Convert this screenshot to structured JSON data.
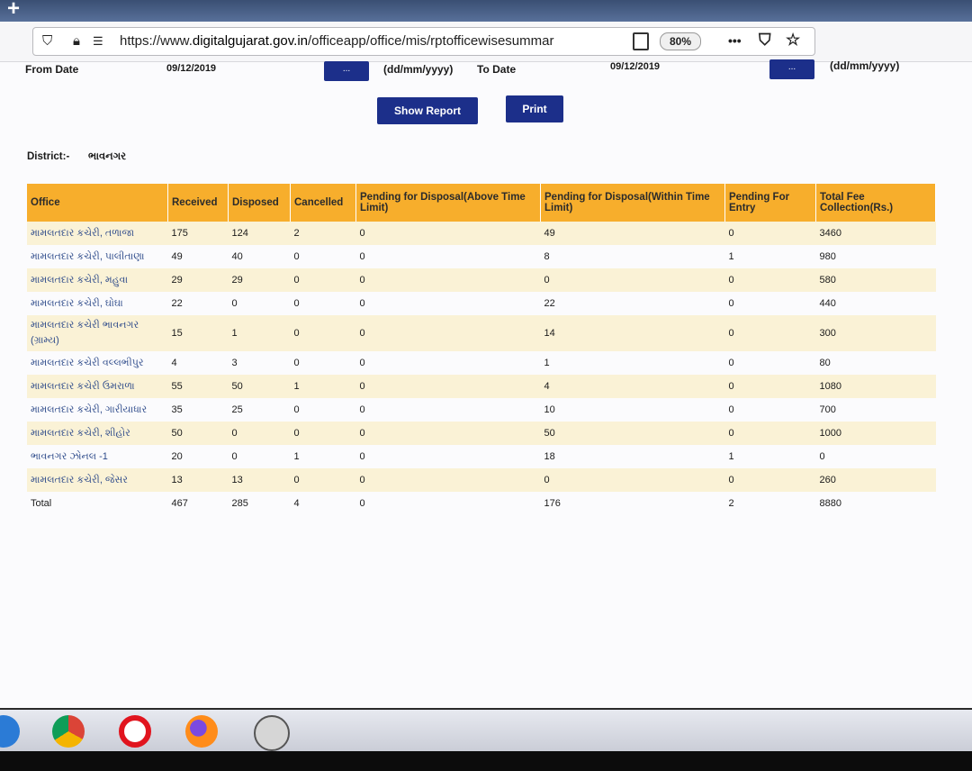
{
  "browser": {
    "url_prefix": "https://www.",
    "url_domain": "digitalgujarat.gov.in",
    "url_path": "/officeapp/office/mis/rptofficewisesummar",
    "zoom": "80%",
    "menu_label": "•••"
  },
  "form": {
    "from_label": "From Date",
    "from_value": "09/12/2019",
    "to_label": "To Date",
    "to_value": "09/12/2019",
    "picker_label": "...",
    "format_hint": "(dd/mm/yyyy)",
    "show_report": "Show Report",
    "print": "Print"
  },
  "district": {
    "label": "District:-",
    "value": "ભાવનગર"
  },
  "table": {
    "headers": [
      "Office",
      "Received",
      "Disposed",
      "Cancelled",
      "Pending for Disposal(Above Time Limit)",
      "Pending for Disposal(Within Time Limit)",
      "Pending For Entry",
      "Total Fee Collection(Rs.)"
    ],
    "rows": [
      [
        "મામલતદાર કચેરી, તળાજા",
        "175",
        "124",
        "2",
        "0",
        "49",
        "0",
        "3460"
      ],
      [
        "મામલતદાર કચેરી, પાલીતાણા",
        "49",
        "40",
        "0",
        "0",
        "8",
        "1",
        "980"
      ],
      [
        "મામલતદાર કચેરી, મહુવા",
        "29",
        "29",
        "0",
        "0",
        "0",
        "0",
        "580"
      ],
      [
        "મામલતદાર કચેરી, ઘોઘા",
        "22",
        "0",
        "0",
        "0",
        "22",
        "0",
        "440"
      ],
      [
        "મામલતદાર કચેરી ભાવનગર (ગ્રામ્ય)",
        "15",
        "1",
        "0",
        "0",
        "14",
        "0",
        "300"
      ],
      [
        "મામલતદાર કચેરી વલ્લભીપુર",
        "4",
        "3",
        "0",
        "0",
        "1",
        "0",
        "80"
      ],
      [
        "મામલતદાર કચેરી ઉમરાળા",
        "55",
        "50",
        "1",
        "0",
        "4",
        "0",
        "1080"
      ],
      [
        "મામલતદાર કચેરી, ગારીયાધાર",
        "35",
        "25",
        "0",
        "0",
        "10",
        "0",
        "700"
      ],
      [
        "મામલતદાર કચેરી, શીહોર",
        "50",
        "0",
        "0",
        "0",
        "50",
        "0",
        "1000"
      ],
      [
        "ભાવનગર ઝોનલ -1",
        "20",
        "0",
        "1",
        "0",
        "18",
        "1",
        "0"
      ],
      [
        "મામલતદાર કચેરી, જેસર",
        "13",
        "13",
        "0",
        "0",
        "0",
        "0",
        "260"
      ]
    ],
    "total": [
      "Total",
      "467",
      "285",
      "4",
      "0",
      "176",
      "2",
      "8880"
    ]
  }
}
